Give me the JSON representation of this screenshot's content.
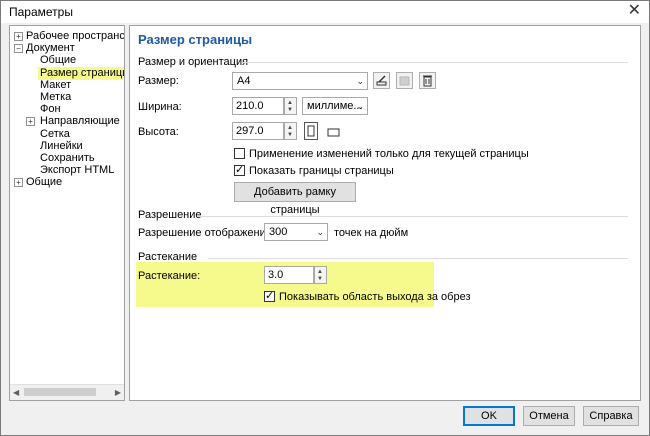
{
  "window": {
    "title": "Параметры"
  },
  "tree": {
    "items": [
      {
        "label": "Рабочее пространство",
        "level": 0,
        "expander": "+"
      },
      {
        "label": "Документ",
        "level": 0,
        "expander": "-"
      },
      {
        "label": "Общие",
        "level": 1
      },
      {
        "label": "Размер страницы",
        "level": 1,
        "selected": true
      },
      {
        "label": "Макет",
        "level": 1
      },
      {
        "label": "Метка",
        "level": 1
      },
      {
        "label": "Фон",
        "level": 1
      },
      {
        "label": "Направляющие",
        "level": 1,
        "expander": "+"
      },
      {
        "label": "Сетка",
        "level": 1
      },
      {
        "label": "Линейки",
        "level": 1
      },
      {
        "label": "Сохранить",
        "level": 1
      },
      {
        "label": "Экспорт HTML",
        "level": 1
      },
      {
        "label": "Общие",
        "level": 0,
        "expander": "+"
      }
    ]
  },
  "panel": {
    "title": "Размер страницы",
    "size_group": {
      "title": "Размер и ориентация",
      "size_label": "Размер:",
      "size_value": "A4",
      "width_label": "Ширина:",
      "width_value": "210.0",
      "unit_value": "миллиме...",
      "height_label": "Высота:",
      "height_value": "297.0",
      "apply_current_only": {
        "label": "Применение изменений только для текущей страницы",
        "checked": false
      },
      "show_borders": {
        "label": "Показать границы страницы",
        "checked": true
      },
      "add_frame_button": "Добавить рамку страницы"
    },
    "resolution_group": {
      "title": "Разрешение",
      "label": "Разрешение отображения:",
      "value": "300",
      "unit": "точек на дюйм"
    },
    "bleed_group": {
      "title": "Растекание",
      "label": "Растекание:",
      "value": "3.0",
      "show_bleed": {
        "label": "Показывать область выхода за обрез",
        "checked": true
      }
    }
  },
  "footer": {
    "ok": "OK",
    "cancel": "Отмена",
    "help": "Справка"
  },
  "colors": {
    "accent_title": "#1e5ba7",
    "highlight": "#f6f98c",
    "default_border": "#0078d7"
  }
}
